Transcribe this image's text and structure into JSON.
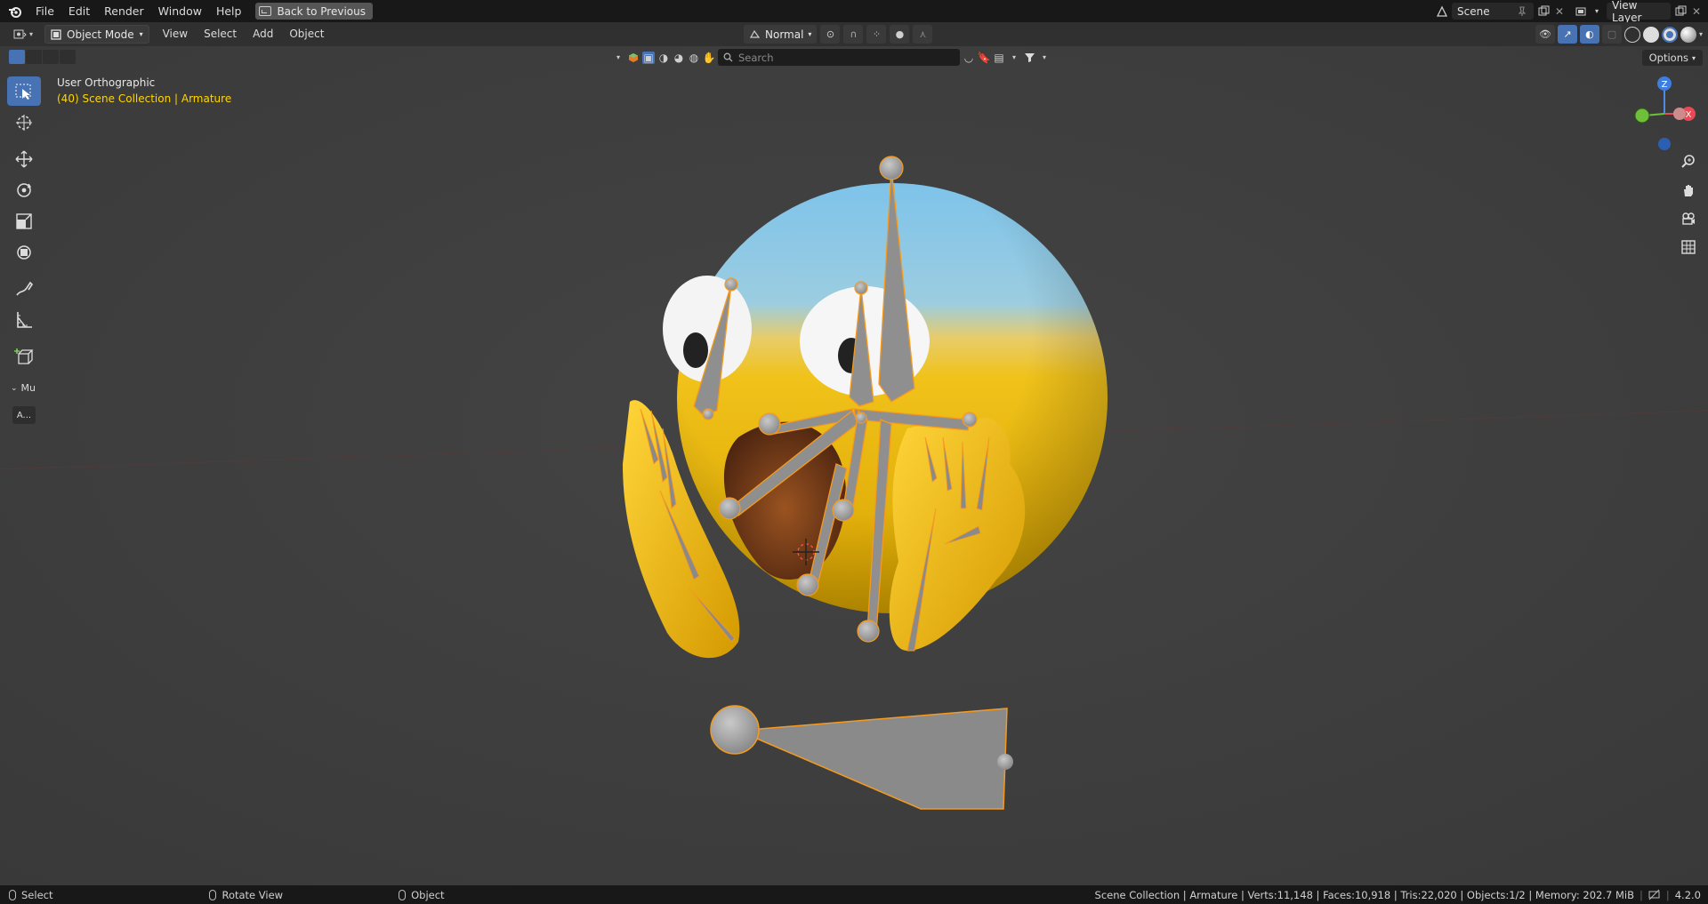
{
  "menubar": {
    "items": [
      "File",
      "Edit",
      "Render",
      "Window",
      "Help"
    ],
    "back_button": "Back to Previous",
    "scene_name": "Scene",
    "view_layer": "View Layer"
  },
  "header": {
    "mode": "Object Mode",
    "menus": [
      "View",
      "Select",
      "Add",
      "Object"
    ],
    "pivot": "Normal"
  },
  "asset_filter": {
    "search_placeholder": "Search"
  },
  "options_label": "Options",
  "viewport": {
    "view_name": "User Orthographic",
    "collection_path": "(40) Scene Collection | Armature"
  },
  "operator_panel": {
    "title": "Mu",
    "button": "A..."
  },
  "gizmo": {
    "axis_z": "Z",
    "axis_x": "X"
  },
  "statusbar": {
    "left": [
      "Select",
      "Rotate View",
      "Object"
    ],
    "stats": "Scene Collection | Armature | Verts:11,148 | Faces:10,918 | Tris:22,020 | Objects:1/2 | Memory: 202.7 MiB",
    "version": "4.2.0"
  },
  "colors": {
    "accent": "#4772b3",
    "selection_outline": "#ff9d2a",
    "overlay_text": "#ffd500"
  }
}
